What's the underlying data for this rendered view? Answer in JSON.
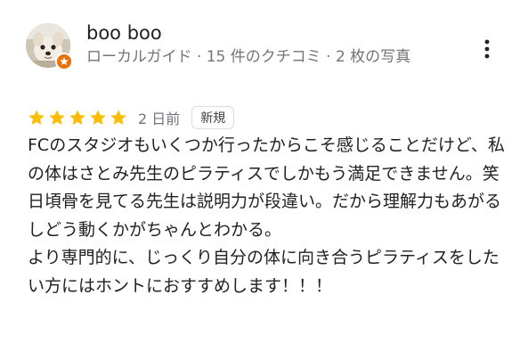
{
  "reviewer": {
    "name": "boo boo",
    "meta": "ローカルガイド · 15 件のクチコミ · 2 枚の写真"
  },
  "rating": {
    "stars": 5,
    "max": 5,
    "star_color": "#fbbc04"
  },
  "review": {
    "date": "2 日前",
    "badge": "新規",
    "paragraphs": [
      "FCのスタジオもいくつか行ったからこそ感じることだけど、私の体はさとみ先生のピラティスでしかもう満足できません。笑",
      "日頃骨を見てる先生は説明力が段違い。だから理解力もあがるしどう動くかがちゃんとわかる。",
      "より専門的に、じっくり自分の体に向き合うピラティスをしたい方にはホントにおすすめします！！！"
    ]
  },
  "icons": {
    "menu": "more-vert-icon",
    "badge": "local-guide-badge-icon",
    "star": "star-icon"
  },
  "colors": {
    "local_guide_badge": "#e8710a",
    "secondary_text": "#70757a",
    "primary_text": "#202124"
  }
}
